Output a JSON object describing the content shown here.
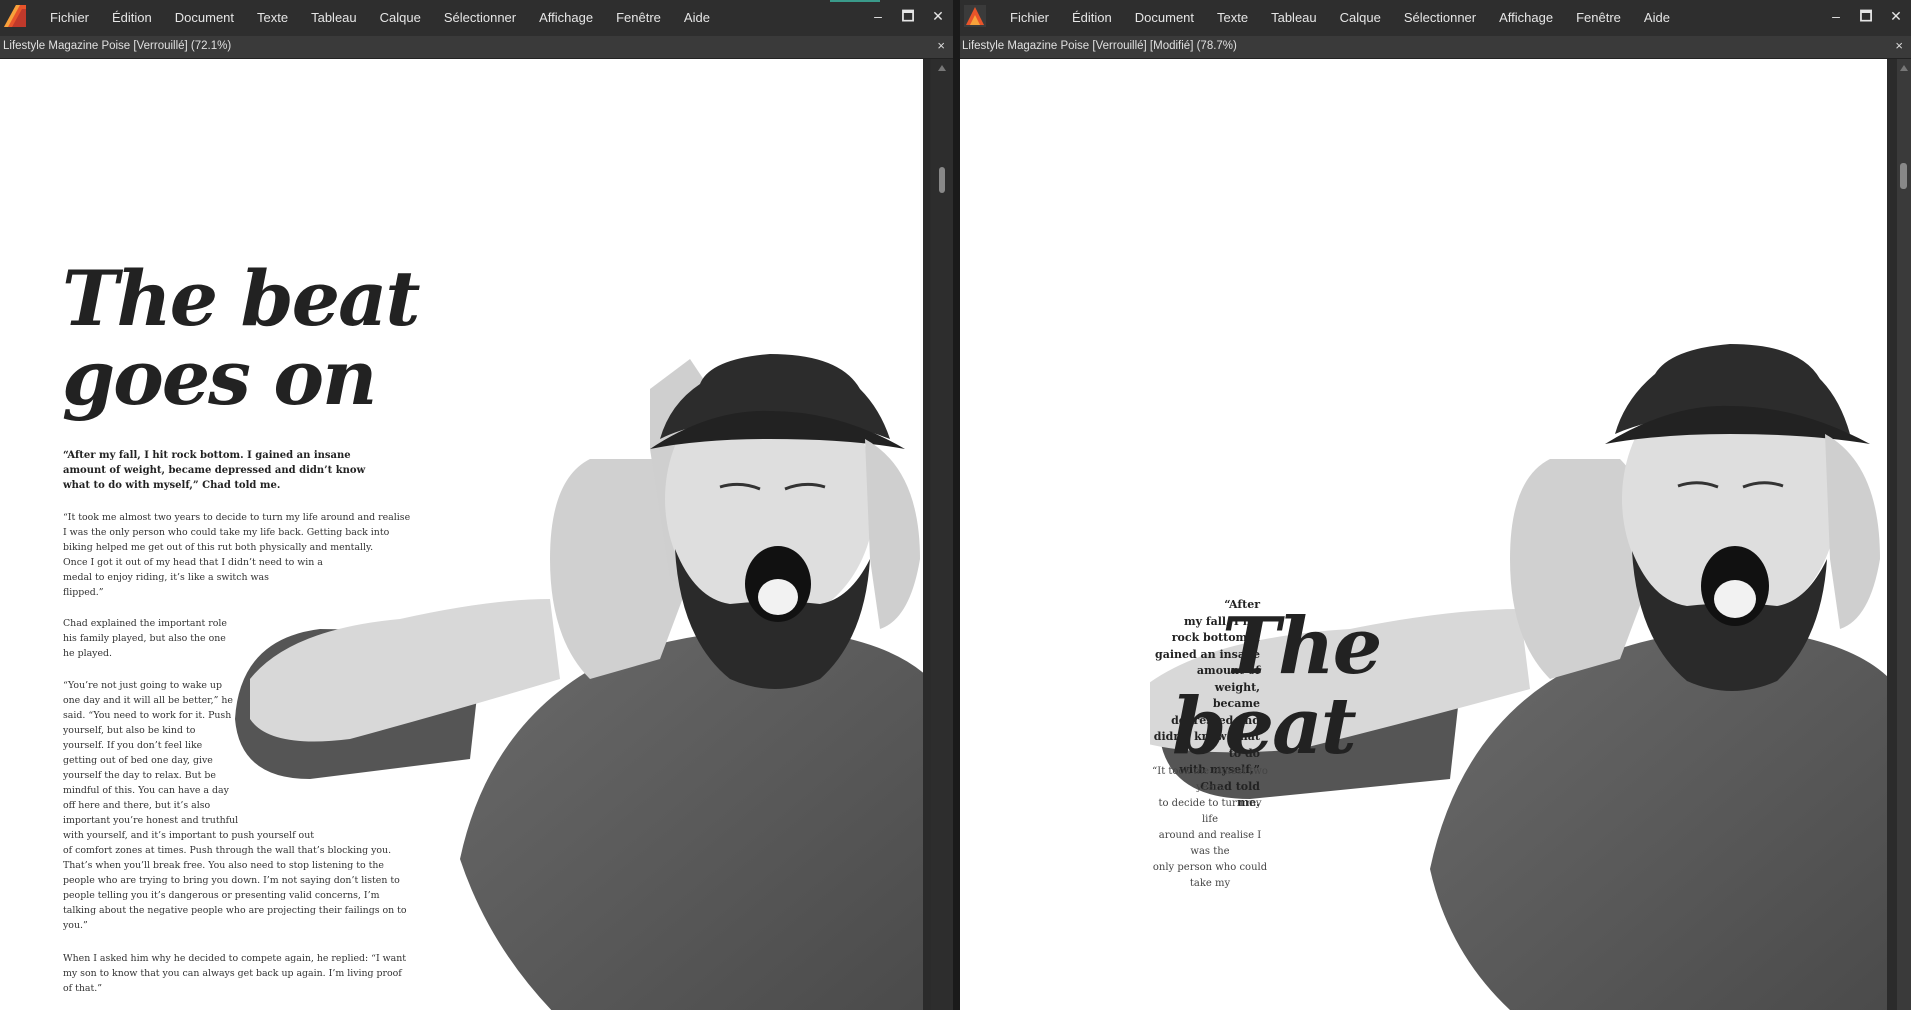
{
  "app": {
    "menus": [
      "Fichier",
      "Édition",
      "Document",
      "Texte",
      "Tableau",
      "Calque",
      "Sélectionner",
      "Affichage",
      "Fenêtre",
      "Aide"
    ],
    "controls": {
      "minimize": "–",
      "maximize": "🗖",
      "close": "✕"
    }
  },
  "left_pane": {
    "doc_title": "Lifestyle Magazine Poise [Verrouillé] (72.1%)",
    "tab_close": "×",
    "article": {
      "headline_line1": "The beat",
      "headline_line2": "goes on",
      "lead": "“After my fall, I hit rock bottom. I gained an insane amount of weight, became depressed and didn’t know what to do with myself,” Chad told me.",
      "para1_lines": [
        "“It took me almost two years to decide to turn my life around and realise",
        "I was the only person who could take my life back. Getting back into",
        "biking helped me get out of this rut both physically and mentally.",
        "Once I got it out of my head that I didn’t need to win a",
        "medal to enjoy riding, it’s like a switch was",
        "flipped.”"
      ],
      "para2_lines": [
        "Chad explained the important role",
        "his family played, but also the one",
        "he played."
      ],
      "para3_lines": [
        "“You’re not just going to wake up",
        "one day and it will all be better,” he",
        "said. “You need to work for it. Push",
        "yourself, but also be kind to",
        "yourself. If you don’t feel like",
        "getting out of bed one day, give",
        "yourself the day to relax. But be",
        "mindful of this. You can have a day",
        "off here and there, but it’s also",
        "important you’re honest and truthful",
        "with yourself, and it’s important to push yourself out",
        "of comfort zones at times. Push through the wall that’s blocking you.",
        "That’s when you’ll break free. You also need to stop listening to the",
        "people who are trying to bring you down. I’m not saying don’t listen to",
        "people telling you it’s dangerous or presenting valid concerns, I’m",
        "talking about the negative people who are projecting their failings on to",
        "you.”"
      ],
      "para4_lines": [
        "When I asked him why he decided to compete again, he replied: “I want",
        "my son to know that you can always get back up again. I’m living proof",
        "of that.”"
      ]
    }
  },
  "right_pane": {
    "doc_title": "Lifestyle Magazine Poise [Verrouillé] [Modifié] (78.7%)",
    "tab_close": "×",
    "article": {
      "headline_line1": "The",
      "headline_line2": "beat",
      "wrap_lead_lines": [
        "“After",
        "my fall, I hit",
        "rock bottom. I",
        "gained an insane",
        "amount of weight,",
        "became depressed and",
        "didn’t know what to do",
        "with myself,” Chad told",
        "me."
      ],
      "wrap_body_lines": [
        "“It took me almost two years",
        "to decide to turn my life",
        "around and realise I was the",
        "only person who could",
        "take my"
      ]
    }
  },
  "colors": {
    "accent": "#3a9a8a",
    "logo_orange": "#f07c3c",
    "logo_red": "#c0392b"
  }
}
